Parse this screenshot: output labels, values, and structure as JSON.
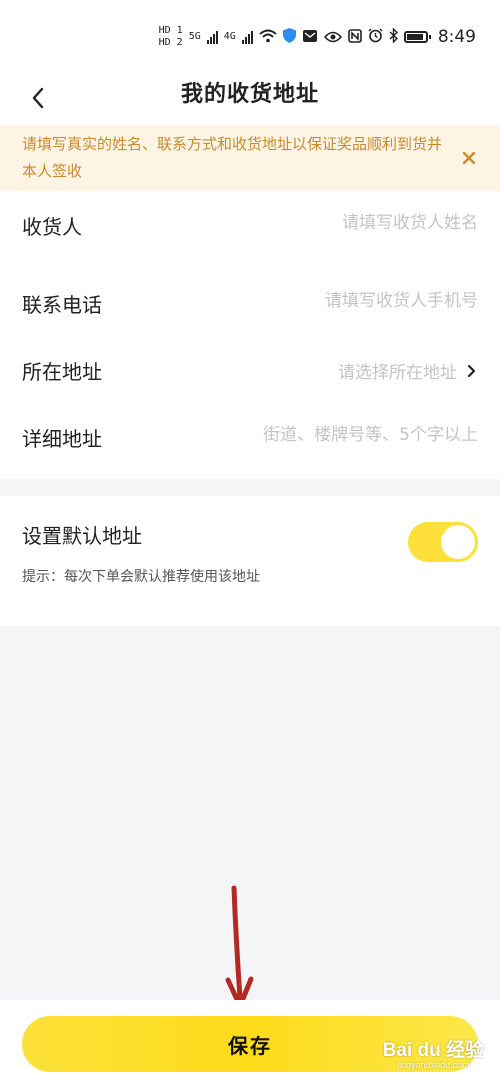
{
  "status_bar": {
    "sim1": "HD 1",
    "sim2": "HD 2",
    "net1": "5G",
    "net2": "4G",
    "time": "8:49"
  },
  "header": {
    "title": "我的收货地址",
    "back_icon": "chevron-left-icon"
  },
  "notice": {
    "text": "请填写真实的姓名、联系方式和收货地址以保证奖品顺利到货并本人签收",
    "close_icon": "close-icon"
  },
  "form": {
    "recipient": {
      "label": "收货人",
      "placeholder": "请填写收货人姓名"
    },
    "phone": {
      "label": "联系电话",
      "placeholder": "请填写收货人手机号"
    },
    "region": {
      "label": "所在地址",
      "placeholder": "请选择所在地址"
    },
    "detail": {
      "label": "详细地址",
      "placeholder": "街道、楼牌号等、5个字以上"
    }
  },
  "default_address": {
    "label": "设置默认地址",
    "hint": "提示：每次下单会默认推荐使用该地址",
    "enabled": true
  },
  "save_button": {
    "label": "保存"
  },
  "watermark": {
    "main": "Bai du 经验",
    "sub": "jingyan.baidu.com"
  },
  "colors": {
    "accent": "#fde13a",
    "notice_bg": "#fdf4e4",
    "notice_text": "#c98b2e",
    "arrow": "#b22a24"
  }
}
